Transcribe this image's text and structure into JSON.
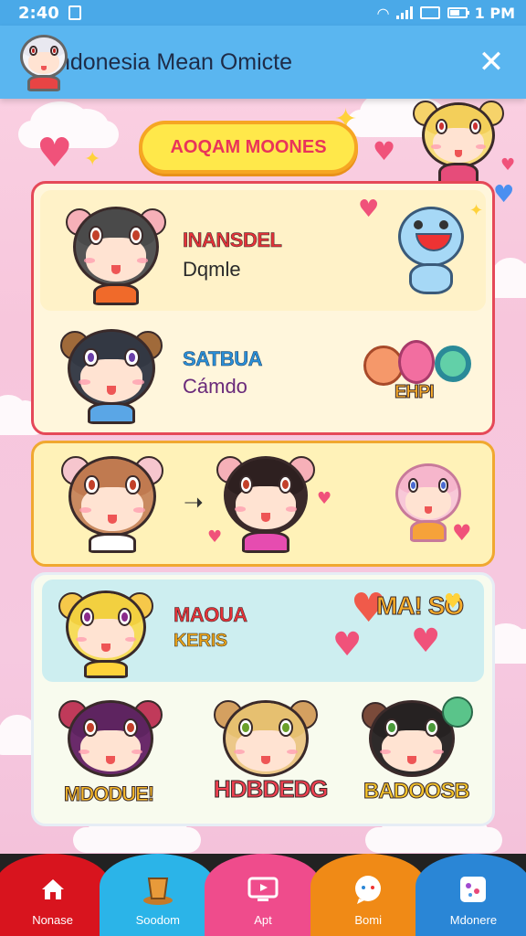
{
  "status_bar": {
    "time": "2:40",
    "right_text": "1 PM"
  },
  "header": {
    "title": "Indonesia Mean Omicte",
    "close_glyph": "✕"
  },
  "banner": {
    "label": "AOQAM MOONES"
  },
  "cards": [
    {
      "rows": [
        {
          "title": "INANSDEL",
          "subtitle": "Dqmle",
          "title_color": "#e53238"
        },
        {
          "title": "SATBUA",
          "subtitle": "Cámdo",
          "title_color": "#2a8fd8",
          "sticker": "EHPI"
        }
      ]
    },
    {
      "rows": []
    },
    {
      "rows": [
        {
          "title": "MAOUA",
          "subtitle": "KERIS",
          "title_color": "#e53238",
          "sticker": "MA! SO"
        }
      ],
      "stickers": [
        "MDODUE!",
        "HDBDEDG",
        "BADOOSB"
      ]
    }
  ],
  "bottom_nav": [
    {
      "label": "Nonase",
      "icon": "home-icon",
      "color": "#d8141e"
    },
    {
      "label": "Soodom",
      "icon": "trophy-icon",
      "color": "#2bb4e8"
    },
    {
      "label": "Apt",
      "icon": "tv-icon",
      "color": "#ef4c8c"
    },
    {
      "label": "Bomi",
      "icon": "chat-bubble-icon",
      "color": "#f08a16"
    },
    {
      "label": "Mdonere",
      "icon": "gallery-icon",
      "color": "#2a86d6"
    }
  ],
  "colors": {
    "header": "#5ab6f0",
    "status_bar": "#4aa9e8",
    "banner_fill": "#ffe84a",
    "card1_border": "#e54858",
    "card2_border": "#f0a830",
    "card3_border": "#dfe6ef"
  }
}
